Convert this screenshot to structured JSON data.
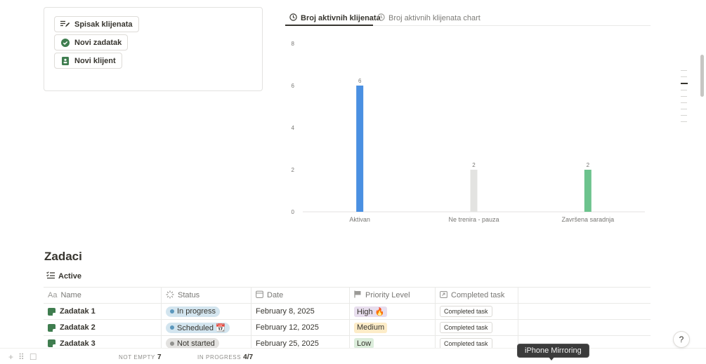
{
  "buttons": [
    {
      "label": "Spisak klijenata",
      "icon": "list-edit-icon"
    },
    {
      "label": "Novi zadatak",
      "icon": "check-circle-icon"
    },
    {
      "label": "Novi klijent",
      "icon": "contact-book-icon"
    }
  ],
  "tabs": [
    {
      "label": "Broj aktivnih klijenata",
      "icon": "clock-icon",
      "active": true
    },
    {
      "label": "Broj aktivnih klijenata chart",
      "icon": "clock-icon",
      "active": false
    }
  ],
  "chart_data": {
    "type": "bar",
    "categories": [
      "Aktivan",
      "Ne trenira - pauza",
      "Završena saradnja"
    ],
    "values": [
      6,
      2,
      2
    ],
    "colors": [
      "#4a90e2",
      "#e3e3e1",
      "#6cc38d"
    ],
    "data_labels": [
      "6",
      "2",
      "2"
    ],
    "ylim": [
      0,
      8
    ],
    "yticks": [
      "0",
      "2",
      "4",
      "6",
      "8"
    ],
    "grid": false,
    "title": "",
    "xlabel": "",
    "ylabel": ""
  },
  "section": {
    "title": "Zadaci",
    "view_label": "Active",
    "view_icon": "list-check-icon"
  },
  "table": {
    "columns": [
      {
        "label": "Name",
        "icon": "Aa"
      },
      {
        "label": "Status",
        "icon": "status-spinner-icon"
      },
      {
        "label": "Date",
        "icon": "calendar-icon"
      },
      {
        "label": "Priority Level",
        "icon": "flag-icon"
      },
      {
        "label": "Completed task",
        "icon": "relation-icon"
      }
    ],
    "rows": [
      {
        "name": "Zadatak 1",
        "status": "In progress",
        "date": "February 8, 2025",
        "priority": "High 🔥",
        "completed": "Completed task"
      },
      {
        "name": "Zadatak 2",
        "status": "Scheduled 📆",
        "date": "February 12, 2025",
        "priority": "Medium",
        "completed": "Completed task"
      },
      {
        "name": "Zadatak 3",
        "status": "Not started",
        "date": "February 25, 2025",
        "priority": "Low",
        "completed": "Completed task"
      }
    ]
  },
  "colors": {
    "status_in_progress_bg": "#d3e5ef",
    "status_in_progress_dot": "#5b97bd",
    "status_scheduled_bg": "#d3e5ef",
    "status_scheduled_dot": "#5b97bd",
    "status_not_started_bg": "#e3e2e0",
    "status_not_started_dot": "#91918e",
    "priority_high_bg": "#e8deee",
    "priority_medium_bg": "#fdecc8",
    "priority_low_bg": "#dbeddb"
  },
  "footer": {
    "not_empty_label": "NOT EMPTY",
    "not_empty_value": "7",
    "in_progress_label": "IN PROGRESS",
    "in_progress_value": "4/7"
  },
  "tooltip": "iPhone Mirroring",
  "help_icon": "?"
}
